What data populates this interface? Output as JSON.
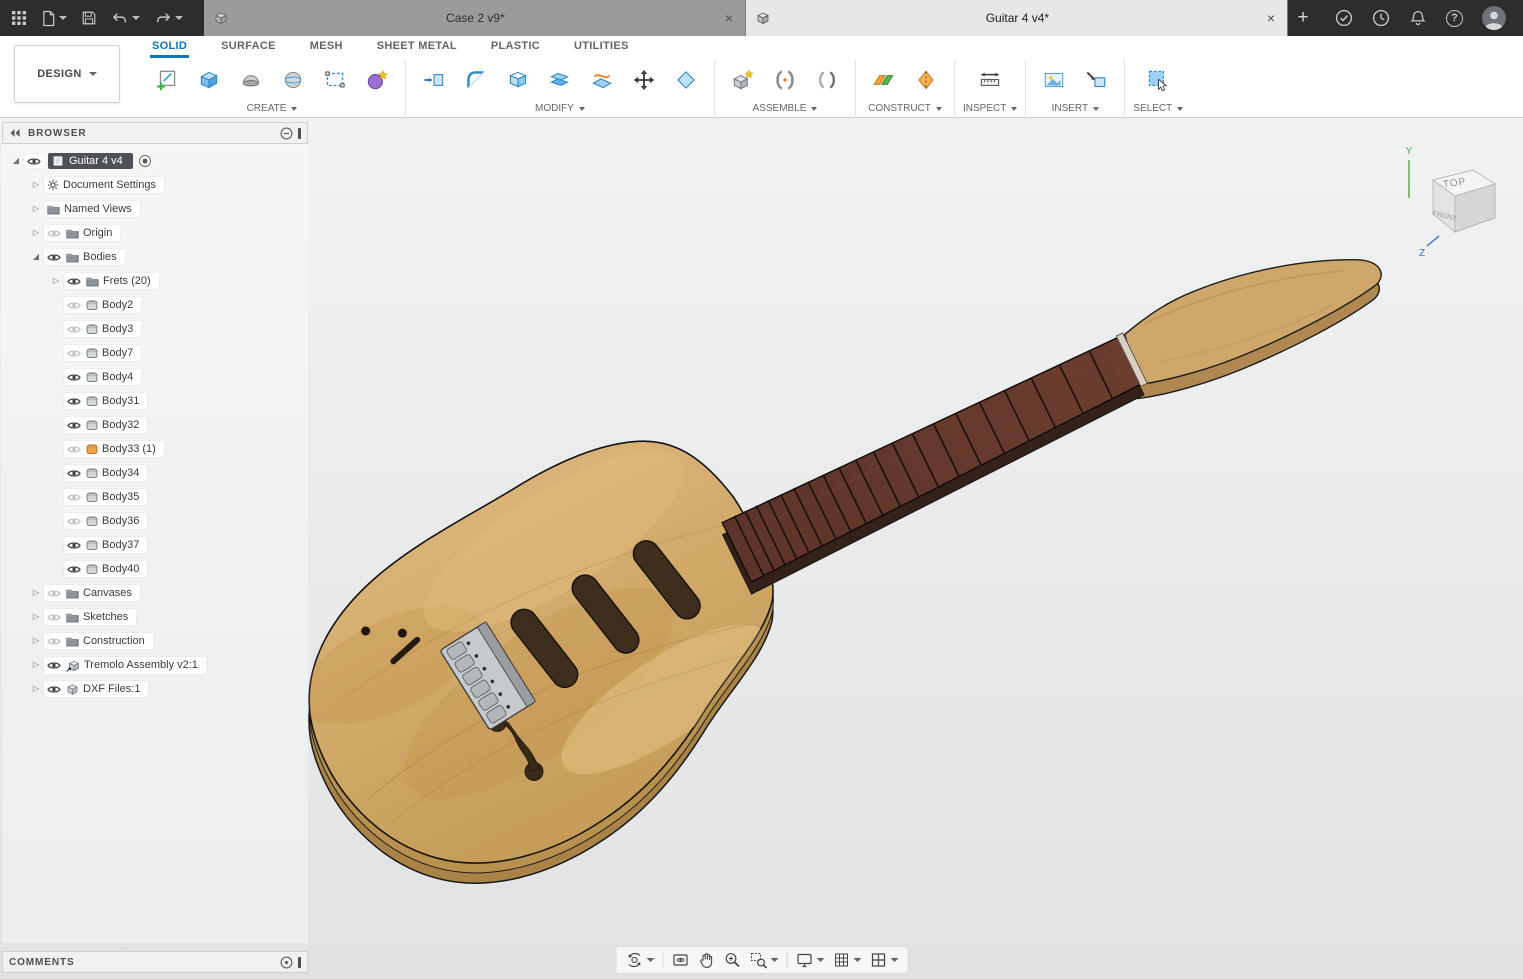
{
  "topbar": {
    "document_tabs": [
      {
        "label": "Case 2 v9*",
        "active": false
      },
      {
        "label": "Guitar 4 v4*",
        "active": true
      }
    ]
  },
  "icons": {
    "close": "×",
    "plus": "+",
    "help": "?",
    "expand_collapsed": "▷",
    "expand_expanded": "◢"
  },
  "toolbar": {
    "design_button": "DESIGN",
    "tabs": [
      "SOLID",
      "SURFACE",
      "MESH",
      "SHEET METAL",
      "PLASTIC",
      "UTILITIES"
    ],
    "active_tab": "SOLID",
    "groups": [
      "CREATE",
      "MODIFY",
      "ASSEMBLE",
      "CONSTRUCT",
      "INSPECT",
      "INSERT",
      "SELECT"
    ],
    "accent_color": "#0d76b8"
  },
  "browser": {
    "title": "BROWSER",
    "items": [
      {
        "label": "Guitar 4 v4",
        "level": 0,
        "arrow": "expanded",
        "eye": "on",
        "icon": "doc",
        "root": true
      },
      {
        "label": "Document Settings",
        "level": 1,
        "arrow": "collapsed",
        "eye": null,
        "icon": "gear"
      },
      {
        "label": "Named Views",
        "level": 1,
        "arrow": "collapsed",
        "eye": null,
        "icon": "folder"
      },
      {
        "label": "Origin",
        "level": 1,
        "arrow": "collapsed",
        "eye": "off",
        "icon": "folder"
      },
      {
        "label": "Bodies",
        "level": 1,
        "arrow": "expanded",
        "eye": "on",
        "icon": "folder"
      },
      {
        "label": "Frets (20)",
        "level": 2,
        "arrow": "collapsed",
        "eye": "on",
        "icon": "folder"
      },
      {
        "label": "Body2",
        "level": 2,
        "arrow": null,
        "eye": "off",
        "icon": "body"
      },
      {
        "label": "Body3",
        "level": 2,
        "arrow": null,
        "eye": "off",
        "icon": "body"
      },
      {
        "label": "Body7",
        "level": 2,
        "arrow": null,
        "eye": "off",
        "icon": "body"
      },
      {
        "label": "Body4",
        "level": 2,
        "arrow": null,
        "eye": "on",
        "icon": "body"
      },
      {
        "label": "Body31",
        "level": 2,
        "arrow": null,
        "eye": "on",
        "icon": "body"
      },
      {
        "label": "Body32",
        "level": 2,
        "arrow": null,
        "eye": "on",
        "icon": "body"
      },
      {
        "label": "Body33 (1)",
        "level": 2,
        "arrow": null,
        "eye": "off",
        "icon": "body-orange"
      },
      {
        "label": "Body34",
        "level": 2,
        "arrow": null,
        "eye": "on",
        "icon": "body"
      },
      {
        "label": "Body35",
        "level": 2,
        "arrow": null,
        "eye": "off",
        "icon": "body"
      },
      {
        "label": "Body36",
        "level": 2,
        "arrow": null,
        "eye": "off",
        "icon": "body"
      },
      {
        "label": "Body37",
        "level": 2,
        "arrow": null,
        "eye": "on",
        "icon": "body"
      },
      {
        "label": "Body40",
        "level": 2,
        "arrow": null,
        "eye": "on",
        "icon": "body"
      },
      {
        "label": "Canvases",
        "level": 1,
        "arrow": "collapsed",
        "eye": "off",
        "icon": "folder"
      },
      {
        "label": "Sketches",
        "level": 1,
        "arrow": "collapsed",
        "eye": "off",
        "icon": "folder"
      },
      {
        "label": "Construction",
        "level": 1,
        "arrow": "collapsed",
        "eye": "off",
        "icon": "folder"
      },
      {
        "label": "Tremolo Assembly v2:1",
        "level": 1,
        "arrow": "collapsed",
        "eye": "on",
        "icon": "component-linked"
      },
      {
        "label": "DXF Files:1",
        "level": 1,
        "arrow": "collapsed",
        "eye": "on",
        "icon": "component"
      }
    ]
  },
  "viewcube": {
    "top_label": "TOP",
    "front_label": "FRONT",
    "axis_y": "Y",
    "axis_z": "Z"
  },
  "navbar_tools": [
    "orbit",
    "look-at",
    "pan",
    "zoom",
    "zoom-window",
    "display-settings",
    "grid-and-snaps",
    "viewports"
  ],
  "comments": {
    "label": "COMMENTS"
  },
  "model": {
    "name": "guitar-body-with-neck",
    "wood_body_color": "#cfa766",
    "fingerboard_color": "#5d342a"
  }
}
